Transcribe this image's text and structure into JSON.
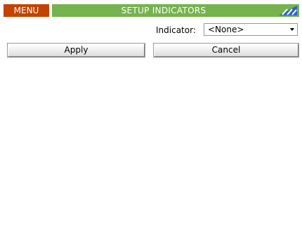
{
  "header": {
    "menu_label": "MENU",
    "title": "SETUP INDICATORS",
    "signal_icon": "signal-strength-icon",
    "colors": {
      "menu_bg": "#c24400",
      "title_bg": "#75b34e"
    }
  },
  "indicator": {
    "label": "Indicator:",
    "selected": "<None>"
  },
  "actions": {
    "apply_label": "Apply",
    "cancel_label": "Cancel"
  }
}
